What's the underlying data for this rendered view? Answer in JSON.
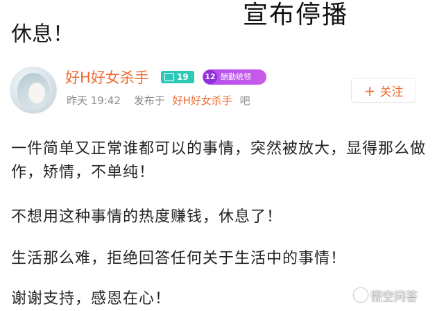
{
  "overlay_title": "宣布停播",
  "post": {
    "title": "休息！",
    "author": {
      "avatar_icon": "avatar-portrait",
      "name": "好H好女杀手",
      "level_badge": "19",
      "level_icon": "cup-icon",
      "vip_level": "12",
      "vip_label": "酬勤统领"
    },
    "meta": {
      "time": "昨天 19:42",
      "posted_in_prefix": "发布于",
      "forum_name": "好H好女杀手",
      "forum_suffix": "吧"
    },
    "follow_button": {
      "plus": "+",
      "label": "关注"
    },
    "paragraphs": [
      "一件简单又正常谁都可以的事情，突然被放大，显得那么做作，矫情，不单纯！",
      "不想用这种事情的热度赚钱，休息了！",
      "生活那么难，拒绝回答任何关于生活中的事情！",
      "谢谢支持，感恩在心！"
    ]
  },
  "watermark": {
    "text": "悟空问答",
    "icon": "wukong-logo-icon"
  },
  "colors": {
    "accent_orange": "#f06a2f",
    "level_badge_teal": "#2ec9b6",
    "vip_badge_purple": "#b14ff0",
    "meta_gray": "#8a8a8a"
  }
}
